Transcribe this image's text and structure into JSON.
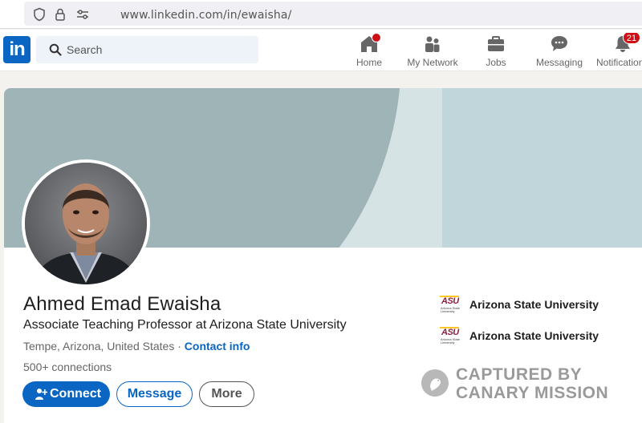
{
  "browser": {
    "url": "www.linkedin.com/in/ewaisha/"
  },
  "nav": {
    "logo": "in",
    "search_placeholder": "Search",
    "items": [
      {
        "label": "Home",
        "icon": "home-icon"
      },
      {
        "label": "My Network",
        "icon": "network-icon"
      },
      {
        "label": "Jobs",
        "icon": "briefcase-icon"
      },
      {
        "label": "Messaging",
        "icon": "messaging-icon"
      },
      {
        "label": "Notifications",
        "icon": "bell-icon",
        "badge": "21"
      }
    ]
  },
  "profile": {
    "name": "Ahmed Emad Ewaisha",
    "headline": "Associate Teaching Professor at Arizona State University",
    "location": "Tempe, Arizona, United States",
    "separator": " · ",
    "contact_info": "Contact info",
    "connections": "500+ connections",
    "buttons": {
      "connect": "Connect",
      "message": "Message",
      "more": "More"
    },
    "education": [
      {
        "logo_mark": "ASU",
        "logo_sub": "Arizona State University",
        "name": "Arizona State University"
      },
      {
        "logo_mark": "ASU",
        "logo_sub": "Arizona State University",
        "name": "Arizona State University"
      }
    ]
  },
  "watermark": {
    "line1": "CAPTURED BY",
    "line2": "CANARY MISSION"
  },
  "colors": {
    "brand": "#0a66c2",
    "badge": "#cc1016",
    "asu": "#8c1d40"
  }
}
